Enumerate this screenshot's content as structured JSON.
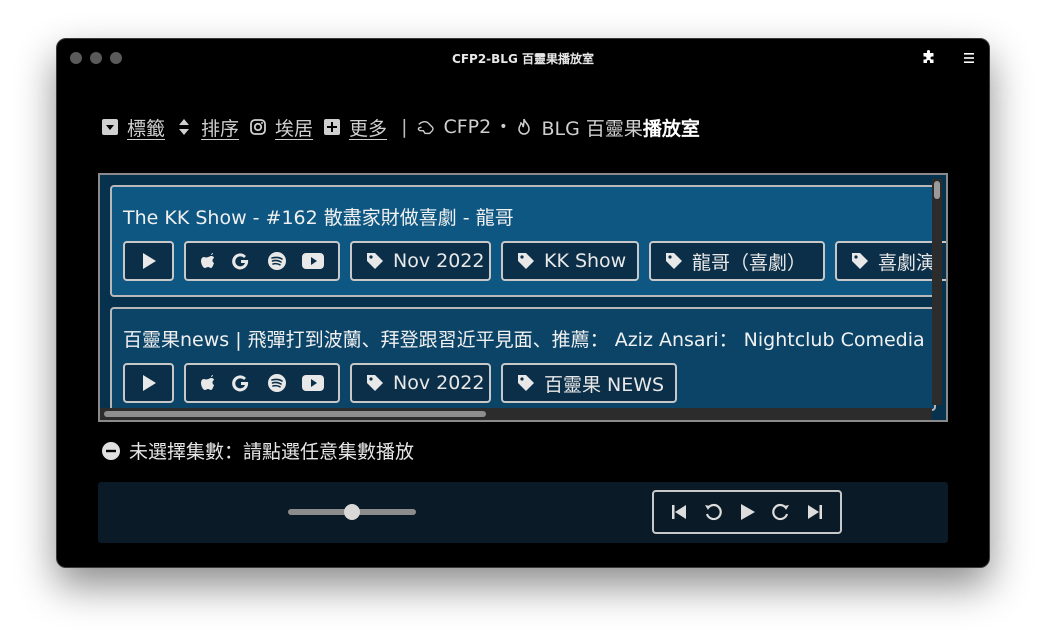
{
  "window": {
    "title": "CFP2-BLG 百靈果播放室",
    "traffic_light_color": "#5a5a5a"
  },
  "topbar": {
    "tags_label": "標籤",
    "sort_label": "排序",
    "instagram_label": "埃居",
    "more_label": "更多",
    "separator": "|",
    "brand_cfp2": "CFP2",
    "brand_dot": "•",
    "brand_blg": "BLG 百靈果",
    "brand_room": "播放室"
  },
  "episodes": [
    {
      "title": "The KK Show - #162 散盡家財做喜劇 - 龍哥",
      "tags": [
        "Nov 2022",
        "KK Show",
        "龍哥（喜劇）",
        "喜劇演"
      ],
      "platform_icons": [
        "apple-podcasts-icon",
        "google-podcasts-icon",
        "spotify-icon",
        "youtube-icon"
      ]
    },
    {
      "title": "百靈果news | 飛彈打到波蘭、拜登跟習近平見面、推薦： Aziz Ansari： Nightclub Comedia",
      "tags": [
        "Nov 2022",
        "百靈果 NEWS"
      ],
      "platform_icons": [
        "apple-podcasts-icon",
        "google-podcasts-icon",
        "spotify-icon",
        "youtube-icon"
      ]
    }
  ],
  "status": {
    "text": "未選擇集數：請點選任意集數播放"
  },
  "player": {
    "volume_fraction": 0.5
  },
  "colors": {
    "card_active": "#0d5782",
    "card": "#0b4467",
    "list_bg": "#07324e",
    "player_bg": "#0a1a26"
  }
}
